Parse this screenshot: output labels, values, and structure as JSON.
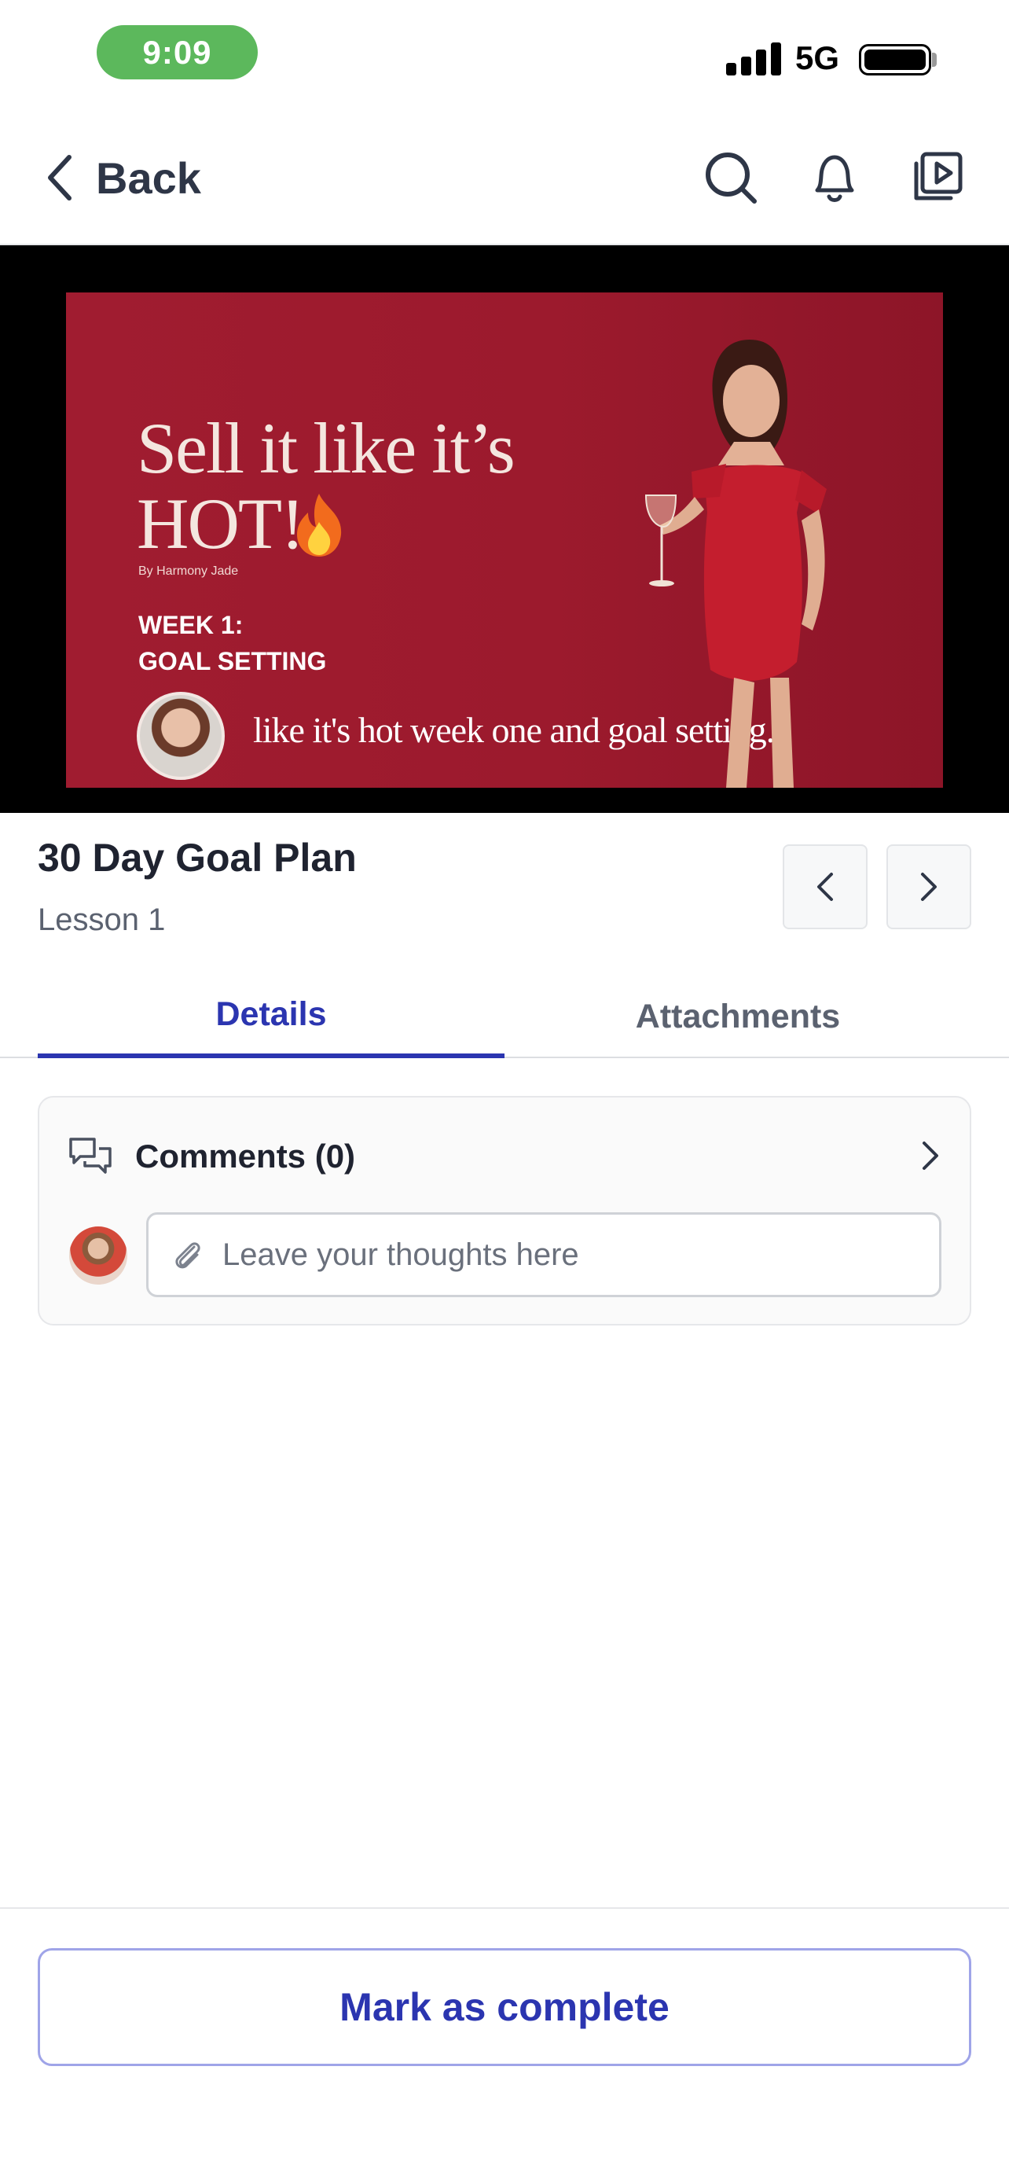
{
  "status_bar": {
    "time": "9:09",
    "network": "5G"
  },
  "nav": {
    "back_label": "Back"
  },
  "video": {
    "slide_title_line1": "Sell it like it’s",
    "slide_title_line2": "HOT!",
    "byline": "By Harmony Jade",
    "week_line1": "WEEK 1:",
    "week_line2": "GOAL SETTING",
    "caption": "like it's hot week one and goal setting."
  },
  "lesson": {
    "title": "30 Day Goal Plan",
    "subtitle": "Lesson 1"
  },
  "tabs": [
    {
      "label": "Details",
      "active": true
    },
    {
      "label": "Attachments",
      "active": false
    }
  ],
  "comments": {
    "label": "Comments (0)",
    "placeholder": "Leave your thoughts here"
  },
  "actions": {
    "mark_complete": "Mark as complete"
  },
  "colors": {
    "accent": "#2b35b0",
    "status_pill": "#5cb85c",
    "slide_bg": "#a01c30"
  }
}
